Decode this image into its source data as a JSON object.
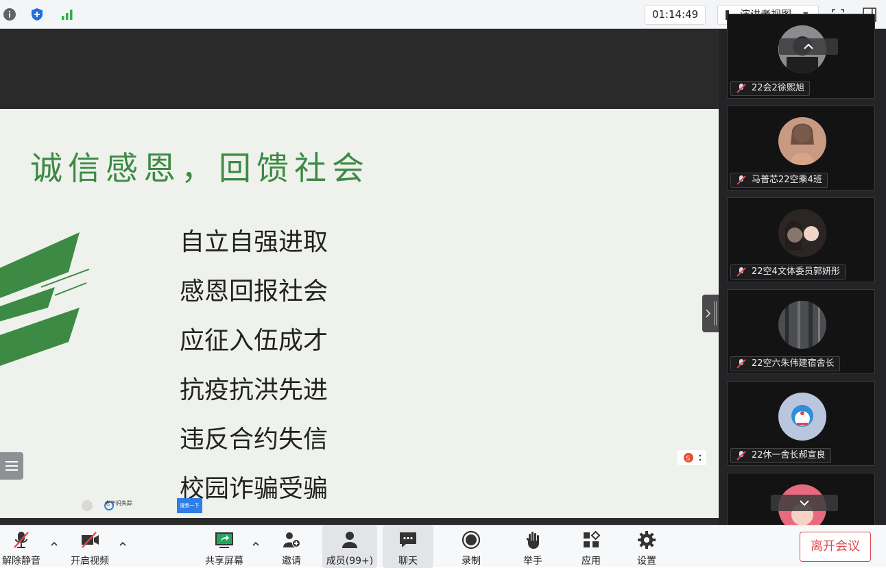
{
  "topbar": {
    "timer": "01:14:49",
    "view_label": "演讲者视图"
  },
  "slide": {
    "title": "诚信感恩，回馈社会",
    "bullets": [
      "自立自强进取",
      "感恩回报社会",
      "应征入伍成才",
      "抗疫抗洪先进",
      "违反合约失信",
      "校园诈骗受骗"
    ],
    "taskbar_text": "老干妈失踪",
    "taskbar_search": "搜索一下"
  },
  "participants": [
    {
      "name": "22会2徐熙旭",
      "muted": true
    },
    {
      "name": "马普芯22空乘4班",
      "muted": true
    },
    {
      "name": "22空4文体委员郭妍彤",
      "muted": true
    },
    {
      "name": "22空六朱伟建宿舍长",
      "muted": true
    },
    {
      "name": "22休一舍长郝宣良",
      "muted": true
    }
  ],
  "toolbar": {
    "unmute": "解除静音",
    "video": "开启视频",
    "share": "共享屏幕",
    "invite": "邀请",
    "members": "成员(99+)",
    "chat": "聊天",
    "record": "录制",
    "raise_hand": "举手",
    "apps": "应用",
    "settings": "设置",
    "leave": "离开会议"
  },
  "colors": {
    "accent_green": "#3d8a45",
    "leave_red": "#e0464e",
    "info_blue": "#1e6fe0",
    "signal_green": "#2bb34a"
  }
}
